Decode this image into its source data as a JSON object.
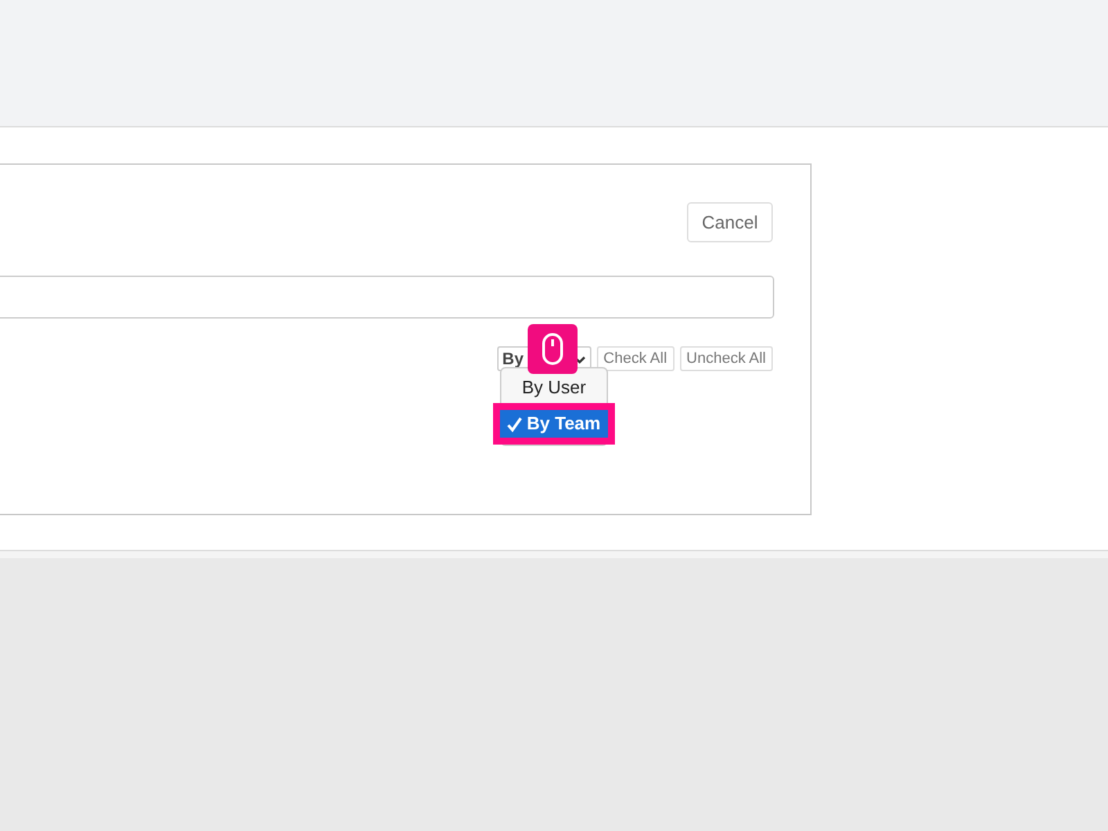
{
  "cancel_button": "Cancel",
  "group_select": {
    "value": "By",
    "options": [
      {
        "label": "By User",
        "selected": false
      },
      {
        "label": "By Team",
        "selected": true
      }
    ]
  },
  "buttons": [
    "Check All",
    "Uncheck All"
  ]
}
